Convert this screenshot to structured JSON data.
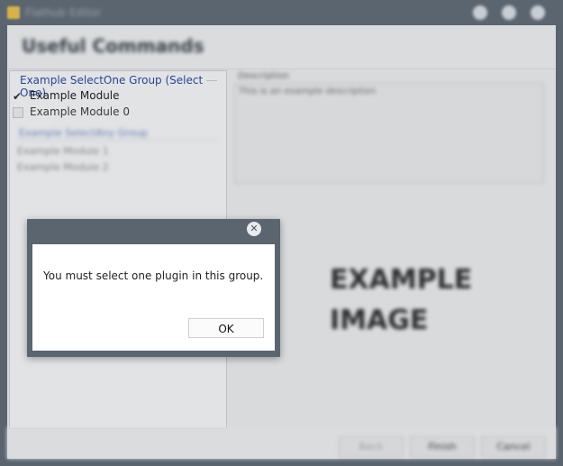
{
  "window": {
    "title": "Flathub Editor",
    "controls": [
      "minimize-icon",
      "maximize-icon",
      "close-icon"
    ]
  },
  "header": {
    "title": "Useful Commands"
  },
  "left_panel": {
    "group1": {
      "label": "Example SelectOne Group (Select One)",
      "options": [
        {
          "label": "Example Module",
          "checked": true
        },
        {
          "label": "Example Module 0",
          "checked": false
        }
      ]
    },
    "group2": {
      "label": "Example SelectAny Group",
      "options": [
        {
          "label": "Example Module 1"
        },
        {
          "label": "Example Module 2"
        }
      ]
    }
  },
  "right_panel": {
    "description_label": "Description",
    "description_text": "This is an example description",
    "image_text_line1": "EXAMPLE",
    "image_text_line2": "IMAGE"
  },
  "bottom_bar": {
    "back_label": "Back",
    "finish_label": "Finish",
    "cancel_label": "Cancel"
  },
  "dialog": {
    "message": "You must select one plugin in this group.",
    "ok_label": "OK",
    "close_glyph": "✕"
  }
}
